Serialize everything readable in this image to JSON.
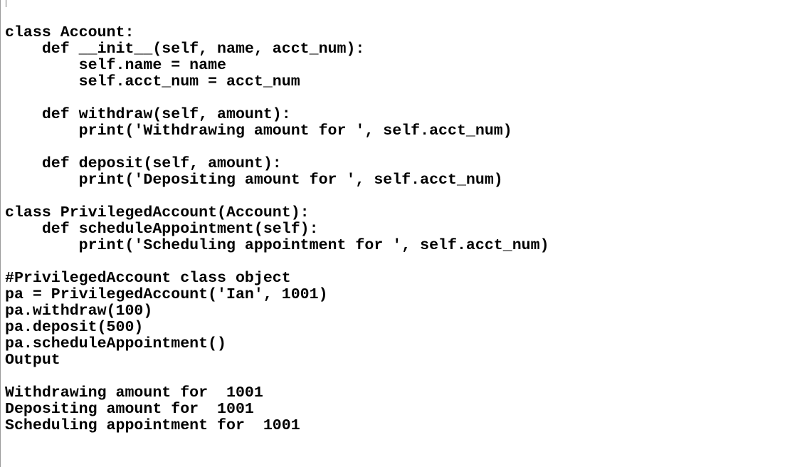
{
  "editor": {
    "lines": [
      "class Account:",
      "    def __init__(self, name, acct_num):",
      "        self.name = name",
      "        self.acct_num = acct_num",
      "",
      "    def withdraw(self, amount):",
      "        print('Withdrawing amount for ', self.acct_num)",
      "",
      "    def deposit(self, amount):",
      "        print('Depositing amount for ', self.acct_num)",
      "",
      "class PrivilegedAccount(Account):",
      "    def scheduleAppointment(self):",
      "        print('Scheduling appointment for ', self.acct_num)",
      "",
      "#PrivilegedAccount class object",
      "pa = PrivilegedAccount('Ian', 1001)",
      "pa.withdraw(100)",
      "pa.deposit(500)",
      "pa.scheduleAppointment()",
      "Output",
      "",
      "Withdrawing amount for  1001",
      "Depositing amount for  1001",
      "Scheduling appointment for  1001"
    ]
  }
}
